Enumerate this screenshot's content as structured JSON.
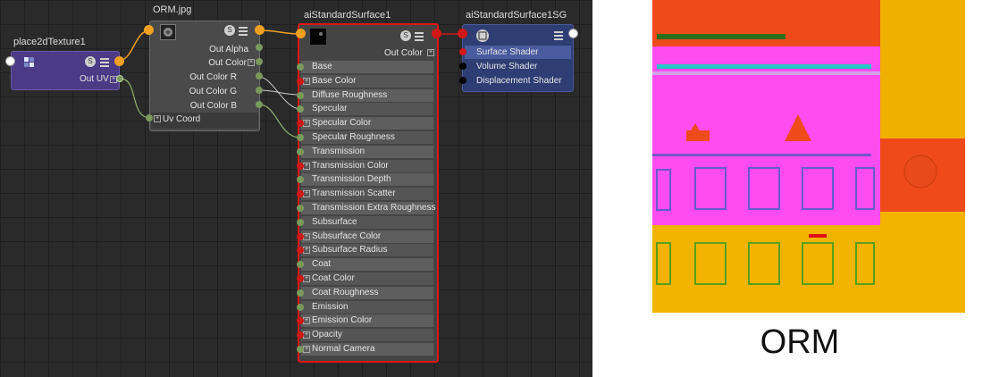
{
  "nodes": {
    "place2d": {
      "title": "place2dTexture1",
      "out_uv": "Out UV"
    },
    "file": {
      "title": "ORM.jpg",
      "attrs": [
        "Out Alpha",
        "Out Color",
        "Out Color R",
        "Out Color G",
        "Out Color B"
      ],
      "uv_coord": "Uv Coord"
    },
    "shader": {
      "title": "aiStandardSurface1",
      "out_color": "Out Color",
      "attrs": [
        "Base",
        "Base Color",
        "Diffuse Roughness",
        "Specular",
        "Specular Color",
        "Specular Roughness",
        "Transmission",
        "Transmission Color",
        "Transmission Depth",
        "Transmission Scatter",
        "Transmission Extra Roughness",
        "Subsurface",
        "Subsurface Color",
        "Subsurface Radius",
        "Coat",
        "Coat Color",
        "Coat Roughness",
        "Emission",
        "Emission Color",
        "Opacity",
        "Normal Camera"
      ]
    },
    "sg": {
      "title": "aiStandardSurface1SG",
      "attrs": [
        "Surface Shader",
        "Volume Shader",
        "Displacement Shader"
      ]
    }
  },
  "icons": {
    "s_badge": "S",
    "list": "list-icon"
  },
  "colors": {
    "place2d_body": "#4b3a86",
    "sg_body": "#2e3d74",
    "shader_select": "#e01515",
    "port_orange": "#f0a020",
    "port_green": "#7a9a5c",
    "port_red": "#d01818"
  },
  "preview_caption": "ORM"
}
